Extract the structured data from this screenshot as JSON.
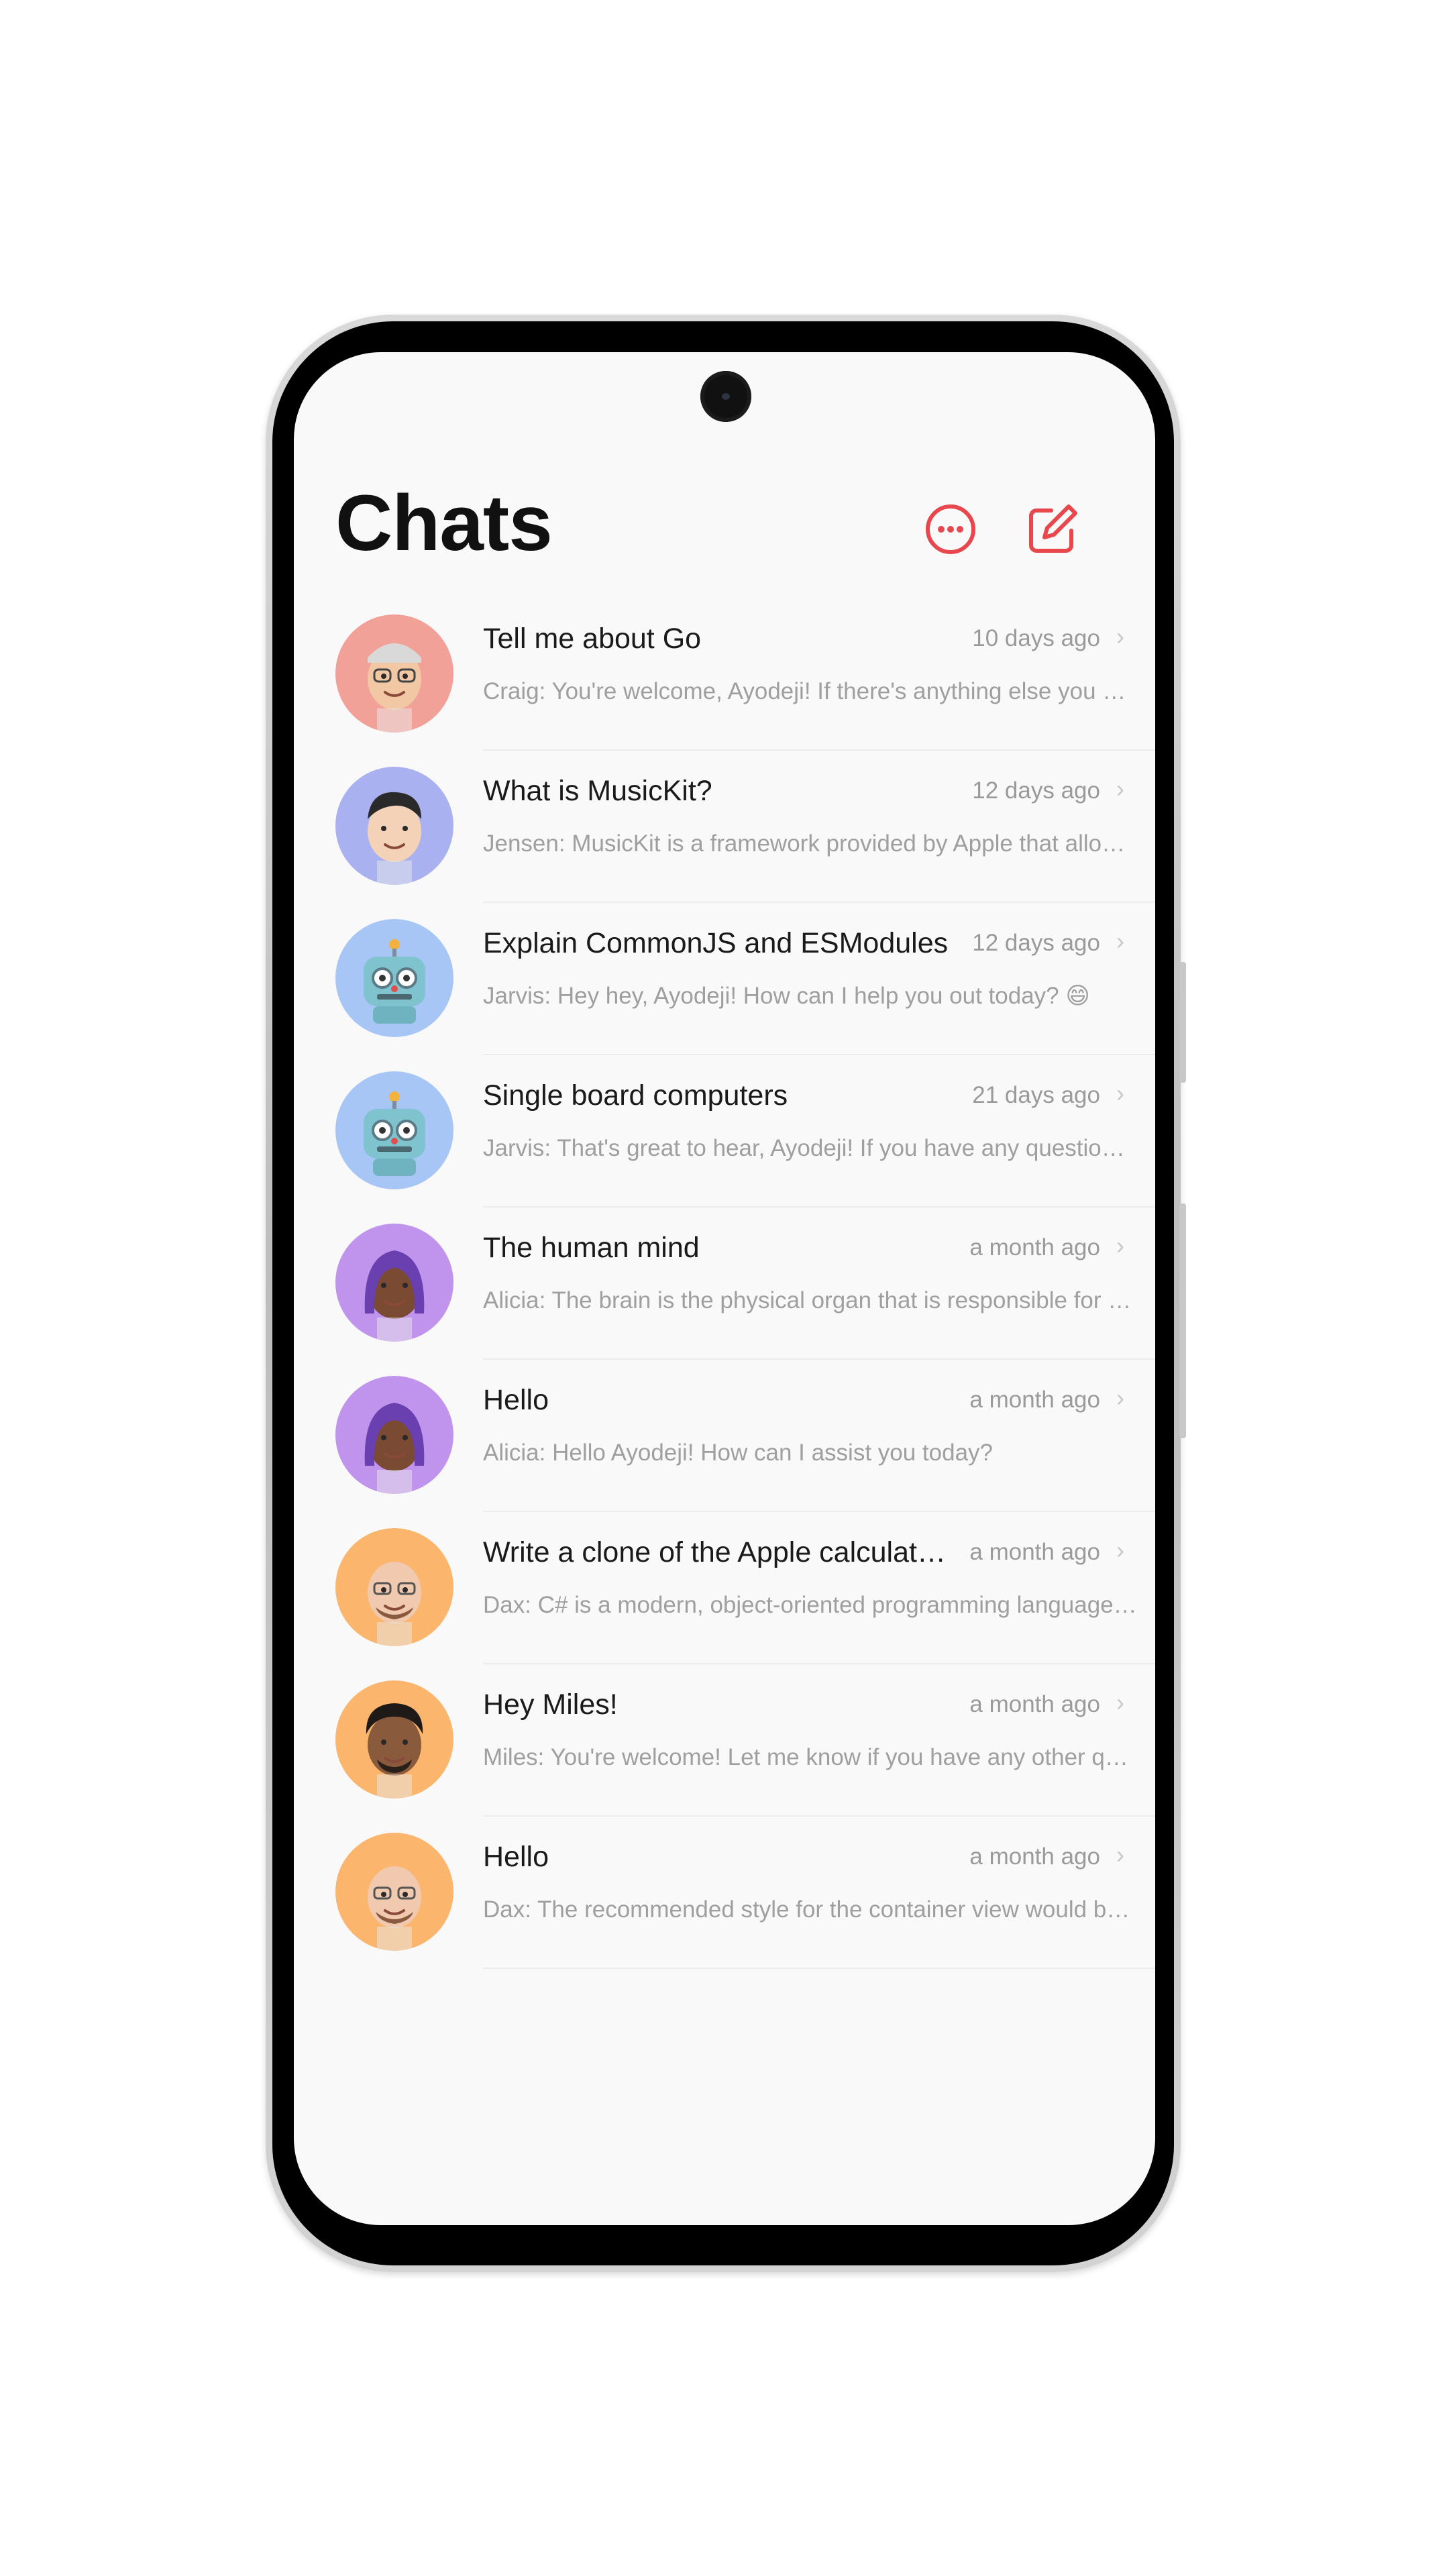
{
  "header": {
    "title": "Chats",
    "more_icon": "more-horizontal-circle-icon",
    "compose_icon": "compose-icon",
    "accent_color": "#e8474d"
  },
  "chats": [
    {
      "title": "Tell me about Go",
      "time": "10 days ago",
      "preview": "Craig: You're welcome, Ayodeji! If there's anything else you need help with, feel free to ask.",
      "avatar_color": "#f2a199",
      "avatar_name": "craig-memoji"
    },
    {
      "title": "What is MusicKit?",
      "time": "12 days ago",
      "preview": "Jensen: MusicKit is a framework provided by Apple that allows developers to integrate Apple Music.",
      "avatar_color": "#a9b1f0",
      "avatar_name": "jensen-memoji"
    },
    {
      "title": "Explain CommonJS and ESModules",
      "time": "12 days ago",
      "preview": "Jarvis: Hey hey, Ayodeji! How can I help you out today? 😄",
      "avatar_color": "#a8c6f5",
      "avatar_name": "jarvis-robot"
    },
    {
      "title": "Single board computers",
      "time": "21 days ago",
      "preview": "Jarvis: That's great to hear, Ayodeji! If you have any questions, just let me know.",
      "avatar_color": "#a8c6f5",
      "avatar_name": "jarvis-robot"
    },
    {
      "title": "The human mind",
      "time": "a month ago",
      "preview": "Alicia: The brain is the physical organ that is responsible for controlling the body.",
      "avatar_color": "#c093ec",
      "avatar_name": "alicia-memoji"
    },
    {
      "title": "Hello",
      "time": "a month ago",
      "preview": "Alicia: Hello Ayodeji! How can I assist you today?",
      "avatar_color": "#c093ec",
      "avatar_name": "alicia-memoji"
    },
    {
      "title": "Write a clone of the Apple calculator app",
      "time": "a month ago",
      "preview": "Dax: C# is a modern, object-oriented programming language developed by Microsoft.",
      "avatar_color": "#fbb56c",
      "avatar_name": "dax-memoji"
    },
    {
      "title": "Hey Miles!",
      "time": "a month ago",
      "preview": "Miles: You're welcome! Let me know if you have any other questions.",
      "avatar_color": "#fbb56c",
      "avatar_name": "miles-memoji"
    },
    {
      "title": "Hello",
      "time": "a month ago",
      "preview": "Dax: The recommended style for the container view would be a stack layout.",
      "avatar_color": "#fbb56c",
      "avatar_name": "dax-memoji"
    }
  ]
}
